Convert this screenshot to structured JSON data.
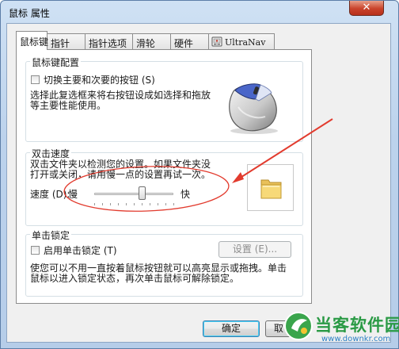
{
  "window": {
    "title": "鼠标 属性",
    "close_glyph": "✕"
  },
  "tabs": [
    {
      "label": "鼠标键",
      "active": true
    },
    {
      "label": "指针"
    },
    {
      "label": "指针选项"
    },
    {
      "label": "滑轮"
    },
    {
      "label": "硬件"
    },
    {
      "label": "UltraNav"
    }
  ],
  "button_config": {
    "title": "鼠标键配置",
    "switch_buttons_label": "切换主要和次要的按钮 (S)",
    "switch_buttons_checked": false,
    "description_line1": "选择此复选框来将右按钮设成如选择和拖放",
    "description_line2": "等主要性能使用。",
    "mouse_icon": "mouse-icon"
  },
  "double_click": {
    "title": "双击速度",
    "description_line1": "双击文件夹以检测您的设置。如果文件夹没",
    "description_line2": "打开或关闭，请用慢一点的设置再试一次。",
    "speed_label": "速度 (D):",
    "slow_label": "慢",
    "fast_label": "快",
    "speed_fraction": 0.6,
    "test_icon": "folder-icon"
  },
  "click_lock": {
    "title": "单击锁定",
    "enable_label": "启用单击锁定 (T)",
    "enable_checked": false,
    "settings_button": "设置 (E)...",
    "description_line1": "使您可以不用一直按着鼠标按钮就可以高亮显示或拖拽。单击",
    "description_line2": "鼠标以进入锁定状态，再次单击鼠标可解除锁定。"
  },
  "footer": {
    "ok_button": "确定",
    "cancel_button": "取"
  },
  "annotation": {
    "ellipse_color": "#e23b2e",
    "arrow_color": "#e23b2e"
  },
  "watermark": {
    "site_name": "当客软件园",
    "url": "www.downkr.com",
    "accent_color": "#2a9a45"
  }
}
